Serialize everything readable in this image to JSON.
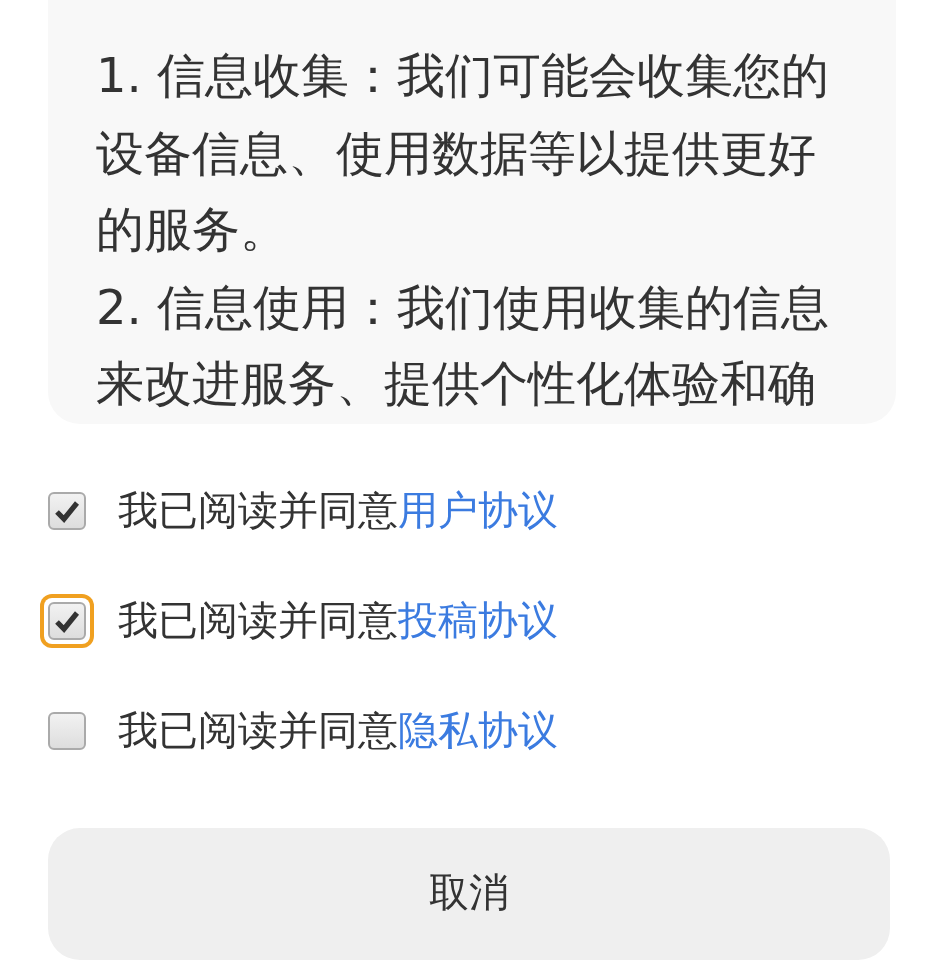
{
  "agreement_panel": {
    "paragraphs": [
      "1. 信息收集：我们可能会收集您的设备信息、使用数据等以提供更好的服务。",
      "2. 信息使用：我们使用收集的信息来改进服务、提供个性化体验和确"
    ]
  },
  "consents": [
    {
      "text": "我已阅读并同意",
      "link": "用户协议",
      "checked": true,
      "focused": false
    },
    {
      "text": "我已阅读并同意",
      "link": "投稿协议",
      "checked": true,
      "focused": true
    },
    {
      "text": "我已阅读并同意",
      "link": "隐私协议",
      "checked": false,
      "focused": false
    }
  ],
  "cancel_button": {
    "label": "取消"
  }
}
